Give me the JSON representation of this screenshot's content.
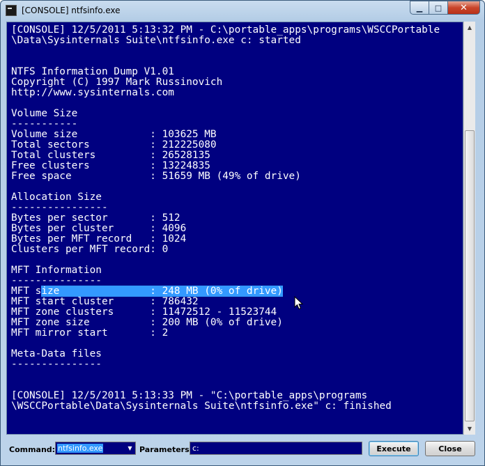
{
  "window": {
    "title": "[CONSOLE] ntfsinfo.exe"
  },
  "console": {
    "lines_before": [
      "[CONSOLE] 12/5/2011 5:13:32 PM - C:\\portable_apps\\programs\\WSCCPortable",
      "\\Data\\Sysinternals Suite\\ntfsinfo.exe c: started",
      "",
      "",
      "NTFS Information Dump V1.01",
      "Copyright (C) 1997 Mark Russinovich",
      "http://www.sysinternals.com",
      "",
      "Volume Size",
      "-----------",
      "Volume size            : 103625 MB",
      "Total sectors          : 212225080",
      "Total clusters         : 26528135",
      "Free clusters          : 13224835",
      "Free space             : 51659 MB (49% of drive)",
      "",
      "Allocation Size",
      "----------------",
      "Bytes per sector       : 512",
      "Bytes per cluster      : 4096",
      "Bytes per MFT record   : 1024",
      "Clusters per MFT record: 0",
      "",
      "MFT Information",
      "---------------"
    ],
    "selected_line": {
      "prefix": "MFT s",
      "selected": "ize               : 248 MB (0% of drive)"
    },
    "lines_after": [
      "MFT start cluster      : 786432",
      "MFT zone clusters      : 11472512 - 11523744",
      "MFT zone size          : 200 MB (0% of drive)",
      "MFT mirror start       : 2",
      "",
      "Meta-Data files",
      "---------------",
      "",
      "",
      "[CONSOLE] 12/5/2011 5:13:33 PM - \"C:\\portable_apps\\programs",
      "\\WSCCPortable\\Data\\Sysinternals Suite\\ntfsinfo.exe\" c: finished"
    ]
  },
  "bottom": {
    "command_label": "Command:",
    "command_value": "ntfsinfo.exe",
    "parameters_label": "Parameters:",
    "parameters_value": "c:",
    "execute_label": "Execute",
    "close_label": "Close"
  },
  "icons": {
    "minimize": "minimize-icon",
    "maximize": "maximize-icon",
    "close": "close-icon",
    "dropdown": "chevron-down-icon",
    "scroll_up": "scroll-up-icon",
    "scroll_down": "scroll-down-icon"
  },
  "colors": {
    "console_background": "#000080",
    "console_text": "#ffffff",
    "selection": "#3399ff"
  }
}
